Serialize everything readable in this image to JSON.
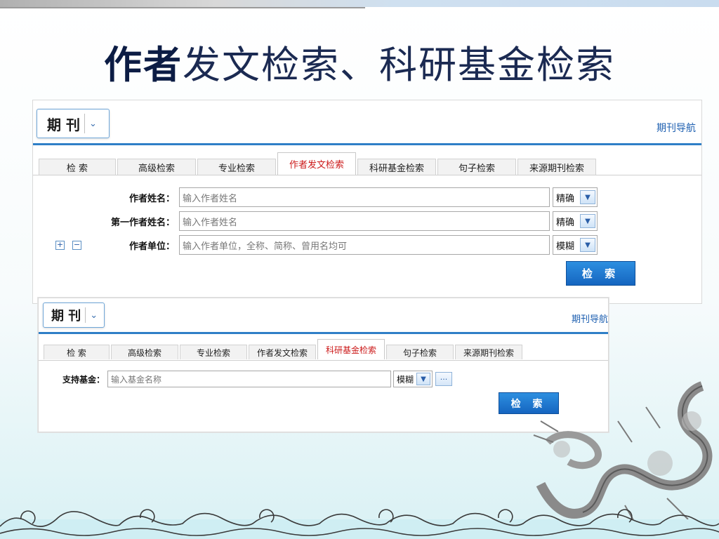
{
  "slide": {
    "title_strong": "作者",
    "title_rest": "发文检索、科研基金检索"
  },
  "panel1": {
    "db_selector": "期 刊",
    "nav_link": "期刊导航",
    "tabs": [
      {
        "label": "检 索",
        "active": false
      },
      {
        "label": "高级检索",
        "active": false
      },
      {
        "label": "专业检索",
        "active": false
      },
      {
        "label": "作者发文检索",
        "active": true
      },
      {
        "label": "科研基金检索",
        "active": false
      },
      {
        "label": "句子检索",
        "active": false
      },
      {
        "label": "来源期刊检索",
        "active": false
      }
    ],
    "fields": [
      {
        "label": "作者姓名：",
        "placeholder": "输入作者姓名",
        "mode": "精确"
      },
      {
        "label": "第一作者姓名：",
        "placeholder": "输入作者姓名",
        "mode": "精确"
      },
      {
        "label": "作者单位：",
        "placeholder": "输入作者单位，全称、简称、曾用名均可",
        "mode": "模糊"
      }
    ],
    "plus_symbol": "+",
    "minus_symbol": "−",
    "search_button": "检 索"
  },
  "panel2": {
    "db_selector": "期 刊",
    "nav_link": "期刊导航",
    "tabs": [
      {
        "label": "检 索",
        "active": false
      },
      {
        "label": "高级检索",
        "active": false
      },
      {
        "label": "专业检索",
        "active": false
      },
      {
        "label": "作者发文检索",
        "active": false
      },
      {
        "label": "科研基金检索",
        "active": true
      },
      {
        "label": "句子检索",
        "active": false
      },
      {
        "label": "来源期刊检索",
        "active": false
      }
    ],
    "fund_field": {
      "label": "支持基金：",
      "placeholder": "输入基金名称",
      "mode": "模糊"
    },
    "more_symbol": "···",
    "search_button": "检 索"
  },
  "icons": {
    "dropdown": "chevron-down-icon",
    "decor": [
      "wave-pattern",
      "dragon-illustration"
    ]
  },
  "colors": {
    "accent_blue": "#2f7fc7",
    "active_tab_text": "#cc1a1a",
    "link": "#1d5fb0"
  }
}
